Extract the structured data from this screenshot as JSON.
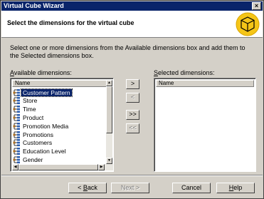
{
  "window": {
    "title": "Virtual Cube Wizard",
    "close_glyph": "×"
  },
  "header": {
    "heading": "Select the dimensions for the virtual cube",
    "icon": "cube-wizard-icon"
  },
  "instructions": "Select one or more dimensions from the Available dimensions box and add them to the Selected dimensions box.",
  "available": {
    "label_accel": "A",
    "label_rest": "vailable dimensions:",
    "column_header": "Name",
    "items": [
      {
        "label": "Customer Pattern",
        "selected": true
      },
      {
        "label": "Store",
        "selected": false
      },
      {
        "label": "Time",
        "selected": false
      },
      {
        "label": "Product",
        "selected": false
      },
      {
        "label": "Promotion Media",
        "selected": false
      },
      {
        "label": "Promotions",
        "selected": false
      },
      {
        "label": "Customers",
        "selected": false
      },
      {
        "label": "Education Level",
        "selected": false
      },
      {
        "label": "Gender",
        "selected": false
      }
    ]
  },
  "selected": {
    "label_accel": "S",
    "label_rest": "elected dimensions:",
    "column_header": "Name",
    "items": []
  },
  "move_buttons": {
    "add": ">",
    "remove": "<",
    "add_all": ">>",
    "remove_all": "<<"
  },
  "buttons": {
    "back_accel": "B",
    "back_prefix": "< ",
    "back_rest": "ack",
    "next": "Next >",
    "cancel": "Cancel",
    "help_accel": "H",
    "help_rest": "elp"
  },
  "colors": {
    "titlebar": "#0a246a",
    "selection": "#0a246a",
    "face": "#d4d0c8",
    "icon_yellow": "#f5c518"
  }
}
